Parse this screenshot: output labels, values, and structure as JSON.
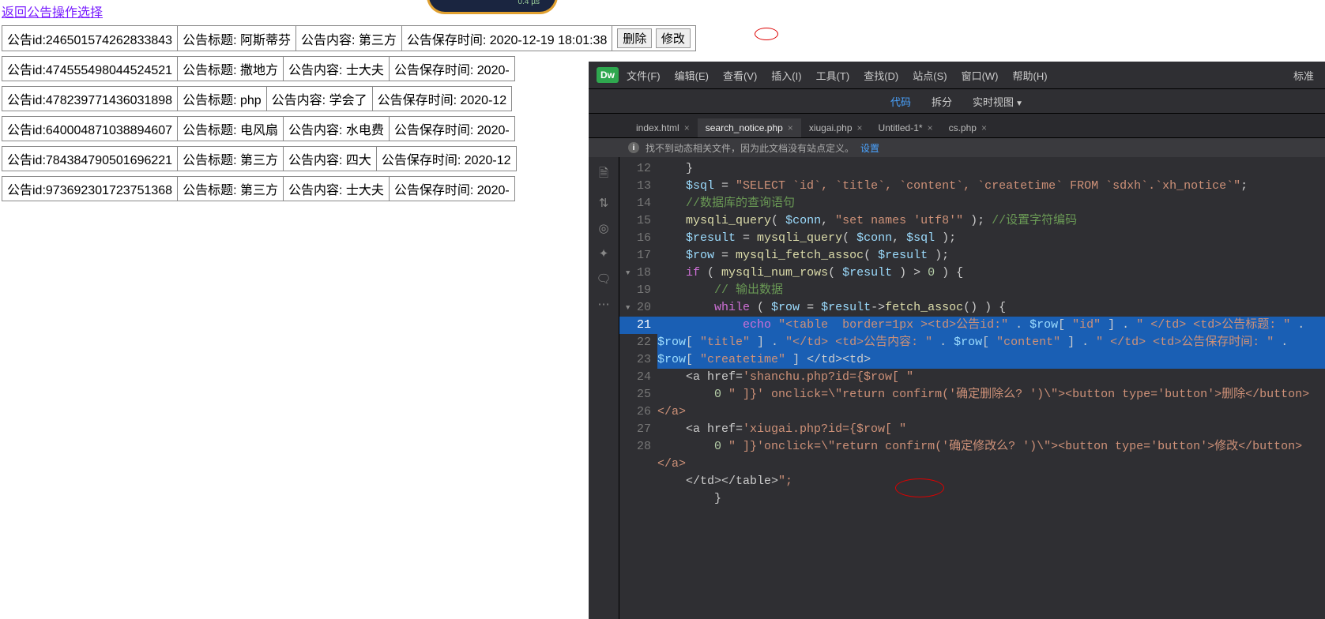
{
  "back_link": "返回公告操作选择",
  "rows": [
    {
      "id": "246501574262833843",
      "title": "阿斯蒂芬",
      "content": "第三方",
      "time": "2020-12-19 18:01:38",
      "full": true
    },
    {
      "id": "474555498044524521",
      "title": "撒地方",
      "content": "士大夫",
      "time": "2020-",
      "full": false
    },
    {
      "id": "478239771436031898",
      "title": "php",
      "content": "学会了",
      "time": "2020-12",
      "full": false
    },
    {
      "id": "640004871038894607",
      "title": "电风扇",
      "content": "水电费",
      "time": "2020-",
      "full": false
    },
    {
      "id": "784384790501696221",
      "title": "第三方",
      "content": "四大",
      "time": "2020-12",
      "full": false
    },
    {
      "id": "973692301723751368",
      "title": "第三方",
      "content": "士大夫",
      "time": "2020-",
      "full": false
    }
  ],
  "labels": {
    "id": "公告id:",
    "title": "公告标题:",
    "content": "公告内容:",
    "time": "公告保存时间:",
    "del": "删除",
    "mod": "修改"
  },
  "dw": {
    "logo": "Dw",
    "menu": [
      "文件(F)",
      "编辑(E)",
      "查看(V)",
      "插入(I)",
      "工具(T)",
      "查找(D)",
      "站点(S)",
      "窗口(W)",
      "帮助(H)"
    ],
    "std": "标准",
    "sub": [
      "代码",
      "拆分",
      "实时视图"
    ],
    "tabs": [
      {
        "label": "index.html",
        "act": false
      },
      {
        "label": "search_notice.php",
        "act": true
      },
      {
        "label": "xiugai.php",
        "act": false
      },
      {
        "label": "Untitled-1*",
        "act": false
      },
      {
        "label": "cs.php",
        "act": false
      }
    ],
    "warn_text": "找不到动态相关文件，因为此文档没有站点定义。",
    "warn_link": "设置",
    "side_icons": [
      "file-icon",
      "swap-icon",
      "target-icon",
      "wand-icon",
      "comment-icon",
      "more-icon"
    ]
  },
  "code_lines": [
    {
      "n": 12,
      "t": "    }"
    },
    {
      "n": 13,
      "t": "    $sql = \"SELECT `id`, `title`, `content`, `createtime` FROM `sdxh`.`xh_notice`\";"
    },
    {
      "n": 14,
      "t": "    //数据库的查询语句"
    },
    {
      "n": 15,
      "t": "    mysqli_query( $conn, \"set names 'utf8'\" ); //设置字符编码"
    },
    {
      "n": 16,
      "t": "    $result = mysqli_query( $conn, $sql );"
    },
    {
      "n": 17,
      "t": "    $row = mysqli_fetch_assoc( $result );"
    },
    {
      "n": 18,
      "t": "    if ( mysqli_num_rows( $result ) > 0 ) {",
      "fold": true
    },
    {
      "n": 19,
      "t": "        // 输出数据"
    },
    {
      "n": 20,
      "t": "        while ( $row = $result->fetch_assoc() ) {",
      "fold": true
    },
    {
      "n": 21,
      "t": "            echo \"<table  border=1px ><td>公告id:\" . $row[ \"id\" ] . \" </td> <td>公告标题: \" . $row[ \"title\" ] . \"</td> <td>公告内容: \" . $row[ \"content\" ] . \" </td> <td>公告保存时间: \" . $row[ \"createtime\" ] </td><td>",
      "sel": true
    },
    {
      "n": 22,
      "t": "    <a href='shanchu.php?id={$row[ \""
    },
    {
      "n": 23,
      "t": "        0 \" ]}' onclick=\\\"return confirm('确定删除么? ')\\\"><button type='button'>删除</button></a>"
    },
    {
      "n": 24,
      "t": "    <a href='xiugai.php?id={$row[ \""
    },
    {
      "n": 25,
      "t": "        0 \" ]}'onclick=\\\"return confirm('确定修改么? ')\\\"><button type='button'>修改</button></a>"
    },
    {
      "n": 26,
      "t": "    </td></table>\";"
    },
    {
      "n": 27,
      "t": "        }"
    },
    {
      "n": 28,
      "t": ""
    }
  ]
}
